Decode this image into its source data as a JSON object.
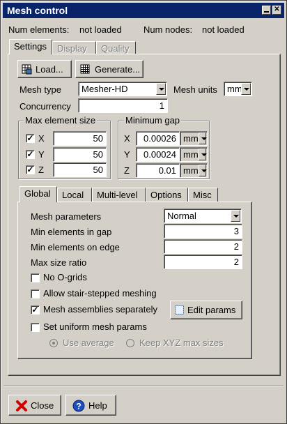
{
  "window": {
    "title": "Mesh control"
  },
  "header": {
    "num_elements_label": "Num elements:",
    "num_elements_value": "not loaded",
    "num_nodes_label": "Num nodes:",
    "num_nodes_value": "not loaded"
  },
  "tabs": [
    {
      "label": "Settings",
      "active": true
    },
    {
      "label": "Display",
      "active": false
    },
    {
      "label": "Quality",
      "active": false
    }
  ],
  "settings": {
    "load_label": "Load...",
    "generate_label": "Generate...",
    "mesh_type_label": "Mesh type",
    "mesh_type_value": "Mesher-HD",
    "mesh_units_label": "Mesh units",
    "mesh_units_value": "mm",
    "concurrency_label": "Concurrency",
    "concurrency_value": "1",
    "max_elem": {
      "title": "Max element size",
      "x_label": "X",
      "x_value": "50",
      "x_checked": true,
      "y_label": "Y",
      "y_value": "50",
      "y_checked": true,
      "z_label": "Z",
      "z_value": "50",
      "z_checked": true
    },
    "min_gap": {
      "title": "Minimum gap",
      "x_label": "X",
      "x_value": "0.00026",
      "x_unit": "mm",
      "y_label": "Y",
      "y_value": "0.00024",
      "y_unit": "mm",
      "z_label": "Z",
      "z_value": "0.01",
      "z_unit": "mm"
    }
  },
  "subtabs": [
    "Global",
    "Local",
    "Multi-level",
    "Options",
    "Misc"
  ],
  "global": {
    "mesh_params_label": "Mesh parameters",
    "mesh_params_value": "Normal",
    "min_elem_gap_label": "Min elements in gap",
    "min_elem_gap_value": "3",
    "min_elem_edge_label": "Min elements on edge",
    "min_elem_edge_value": "2",
    "max_size_ratio_label": "Max size ratio",
    "max_size_ratio_value": "2",
    "no_ogrids_label": "No O-grids",
    "no_ogrids_checked": false,
    "stair_label": "Allow stair-stepped meshing",
    "stair_checked": false,
    "assemblies_label": "Mesh assemblies separately",
    "assemblies_checked": true,
    "edit_params_label": "Edit params",
    "uniform_label": "Set uniform mesh params",
    "uniform_checked": false,
    "use_average_label": "Use average",
    "keep_xyz_label": "Keep XYZ max sizes"
  },
  "footer": {
    "close_label": "Close",
    "help_label": "Help"
  }
}
